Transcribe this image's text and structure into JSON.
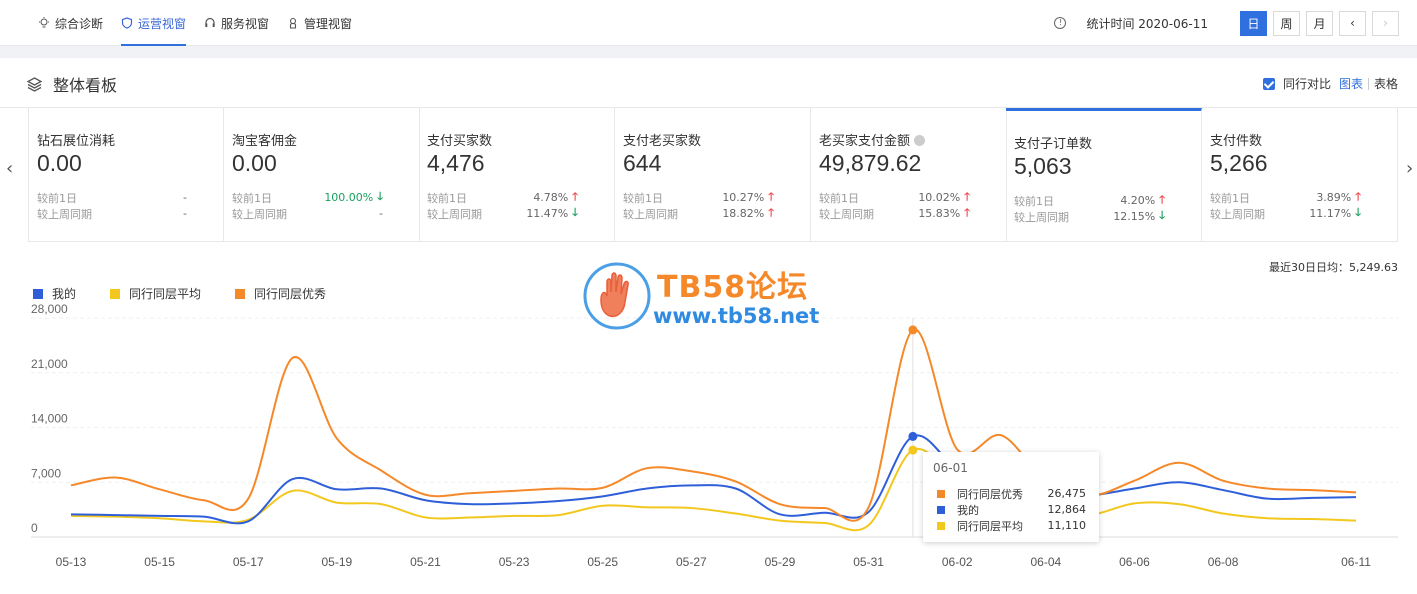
{
  "nav": {
    "tabs": [
      {
        "label": "综合诊断",
        "icon": "bulb-icon"
      },
      {
        "label": "运营视窗",
        "icon": "shield-icon"
      },
      {
        "label": "服务视窗",
        "icon": "headset-icon"
      },
      {
        "label": "管理视窗",
        "icon": "user-icon"
      }
    ],
    "active_tab": "运营视窗",
    "stat_time": "统计时间 2020-06-11",
    "period_buttons": [
      "日",
      "周",
      "月"
    ],
    "active_period": "日",
    "prev": "‹",
    "next": "›"
  },
  "panel": {
    "title": "整体看板",
    "compare_label": "同行对比",
    "view_chart": "图表",
    "view_table": "表格"
  },
  "metrics": [
    {
      "label": "钻石展位消耗",
      "value": "0.00",
      "day_label": "较前1日",
      "day_value": "-",
      "day_dir": "",
      "week_label": "较上周同期",
      "week_value": "-",
      "week_dir": ""
    },
    {
      "label": "淘宝客佣金",
      "value": "0.00",
      "day_label": "较前1日",
      "day_value": "100.00%",
      "day_dir": "down",
      "week_label": "较上周同期",
      "week_value": "-",
      "week_dir": ""
    },
    {
      "label": "支付买家数",
      "value": "4,476",
      "day_label": "较前1日",
      "day_value": "4.78%",
      "day_dir": "up",
      "week_label": "较上周同期",
      "week_value": "11.47%",
      "week_dir": "down"
    },
    {
      "label": "支付老买家数",
      "value": "644",
      "day_label": "较前1日",
      "day_value": "10.27%",
      "day_dir": "up",
      "week_label": "较上周同期",
      "week_value": "18.82%",
      "week_dir": "up"
    },
    {
      "label": "老买家支付金额",
      "value": "49,879.62",
      "day_label": "较前1日",
      "day_value": "10.02%",
      "day_dir": "up",
      "week_label": "较上周同期",
      "week_value": "15.83%",
      "week_dir": "up"
    },
    {
      "label": "支付子订单数",
      "value": "5,063",
      "day_label": "较前1日",
      "day_value": "4.20%",
      "day_dir": "up",
      "week_label": "较上周同期",
      "week_value": "12.15%",
      "week_dir": "down"
    },
    {
      "label": "支付件数",
      "value": "5,266",
      "day_label": "较前1日",
      "day_value": "3.89%",
      "day_dir": "up",
      "week_label": "较上周同期",
      "week_value": "11.17%",
      "week_dir": "down"
    }
  ],
  "watermark": {
    "title": "TB58论坛",
    "url": "www.tb58.net"
  },
  "avg_text": "最近30日日均：5,249.63",
  "chart_data": {
    "type": "line",
    "x": [
      "05-13",
      "05-14",
      "05-15",
      "05-16",
      "05-17",
      "05-18",
      "05-19",
      "05-20",
      "05-21",
      "05-22",
      "05-23",
      "05-24",
      "05-25",
      "05-26",
      "05-27",
      "05-28",
      "05-29",
      "05-30",
      "05-31",
      "06-01",
      "06-02",
      "06-03",
      "06-04",
      "06-05",
      "06-06",
      "06-07",
      "06-08",
      "06-09",
      "06-10",
      "06-11"
    ],
    "x_tick_labels": [
      "05-13",
      "05-15",
      "05-17",
      "05-19",
      "05-21",
      "05-23",
      "05-25",
      "05-27",
      "05-29",
      "05-31",
      "06-02",
      "06-04",
      "06-06",
      "06-08",
      "06-11"
    ],
    "y_ticks": [
      "0",
      "7,000",
      "14,000",
      "21,000",
      "28,000"
    ],
    "ylim": [
      0,
      28000
    ],
    "series": [
      {
        "name": "我的",
        "color": "#2f5fd8",
        "values": [
          2900,
          2800,
          2700,
          2600,
          2000,
          7400,
          6100,
          6200,
          4700,
          4200,
          4300,
          4600,
          5200,
          6200,
          6600,
          6200,
          2900,
          3100,
          3200,
          12864,
          8600,
          5500,
          5100,
          5300,
          6200,
          7000,
          6000,
          4900,
          5000,
          5100
        ]
      },
      {
        "name": "同行同层平均",
        "color": "#f2c81f",
        "values": [
          2700,
          2600,
          2400,
          2000,
          2200,
          5900,
          4400,
          4200,
          2500,
          2500,
          2700,
          2800,
          4000,
          3800,
          3700,
          3000,
          2100,
          1800,
          1500,
          11110,
          7200,
          3100,
          3000,
          2800,
          4300,
          4200,
          3000,
          2400,
          2300,
          2100
        ]
      },
      {
        "name": "同行同层优秀",
        "color": "#f5892a",
        "values": [
          6600,
          7600,
          6100,
          4700,
          4900,
          22900,
          12600,
          8500,
          5400,
          5600,
          5900,
          6200,
          6300,
          8800,
          8400,
          7100,
          4200,
          3700,
          3800,
          26475,
          11200,
          13000,
          7200,
          5300,
          7200,
          9500,
          7200,
          6200,
          6000,
          5700
        ]
      }
    ],
    "highlight": {
      "index": 19,
      "date": "06-01",
      "rows": [
        {
          "name": "同行同层优秀",
          "value": "26,475",
          "color": "#f5892a"
        },
        {
          "name": "我的",
          "value": "12,864",
          "color": "#2f5fd8"
        },
        {
          "name": "同行同层平均",
          "value": "11,110",
          "color": "#f2c81f"
        }
      ]
    }
  }
}
